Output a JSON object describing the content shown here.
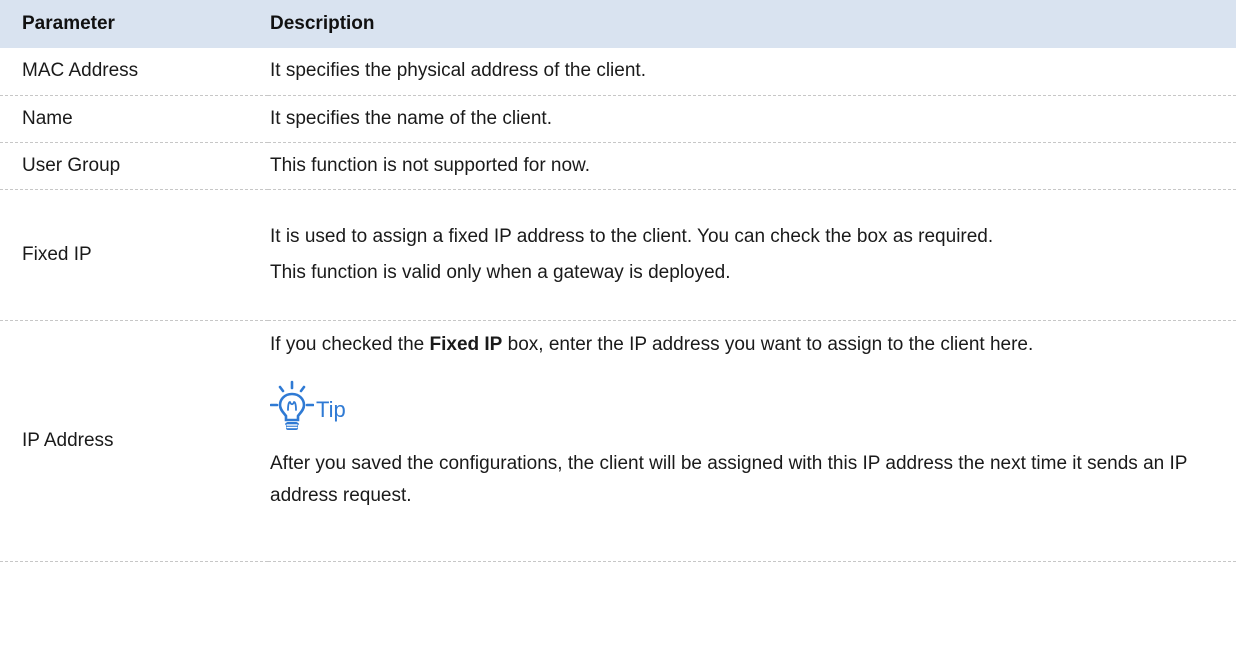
{
  "table": {
    "headers": [
      "Parameter",
      "Description"
    ],
    "rows": [
      {
        "parameter": "MAC Address",
        "description": [
          "It specifies the physical address of the client."
        ]
      },
      {
        "parameter": "Name",
        "description": [
          "It specifies the name of the client."
        ]
      },
      {
        "parameter": "User Group",
        "description": [
          "This function is not supported for now."
        ]
      },
      {
        "parameter": "Fixed IP",
        "description": [
          "It is used to assign a fixed IP address to the client. You can check the box as required.",
          "This function is valid only when a gateway is deployed."
        ]
      },
      {
        "parameter": "IP Address",
        "description_parts": {
          "before": "If you checked the ",
          "bold": "Fixed IP",
          "after": " box, enter the IP address you want to assign to the client here."
        },
        "tip": {
          "icon": "lightbulb-icon",
          "label": "Tip",
          "color": "#2f7ad4"
        },
        "tip_text": "After you saved the configurations, the client will be assigned with this IP address the next time it sends an IP address request."
      }
    ]
  },
  "colors": {
    "header_bg": "#d9e3f0",
    "row_divider": "#c7c7c7"
  }
}
